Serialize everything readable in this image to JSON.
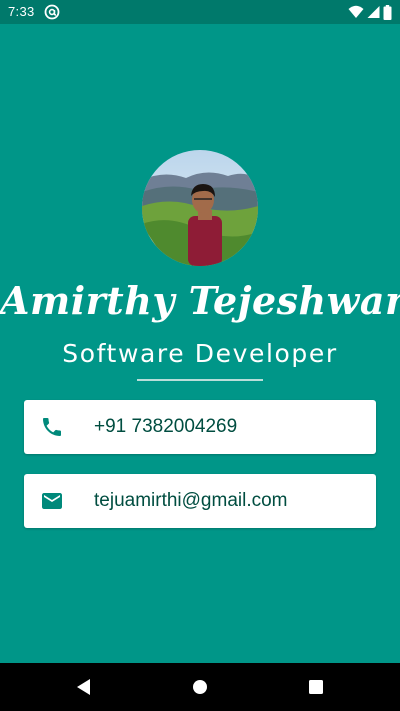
{
  "status_bar": {
    "time": "7:33",
    "app_icon": "at-sign-notification-icon",
    "right_icons": [
      "wifi-icon",
      "signal-icon",
      "battery-icon"
    ]
  },
  "profile": {
    "avatar_icon": "profile-photo",
    "name": "Amirthy Tejeshwar",
    "title": "Software Developer"
  },
  "contacts": {
    "phone": {
      "icon": "phone-icon",
      "value": "+91 7382004269"
    },
    "email": {
      "icon": "email-icon",
      "value": "tejuamirthi@gmail.com"
    }
  },
  "nav": {
    "buttons": [
      "back-icon",
      "home-icon",
      "recent-apps-icon"
    ]
  },
  "colors": {
    "background": "#009688",
    "status_bar": "#00796B",
    "card": "#FFFFFF",
    "icon_and_text": "#004D40",
    "divider": "#B9DED9",
    "nav_bar": "#000000"
  }
}
